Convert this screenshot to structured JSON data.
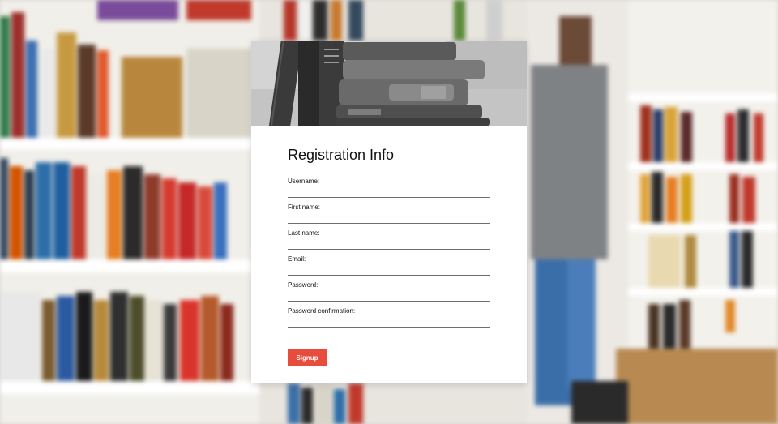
{
  "form": {
    "title": "Registration Info",
    "fields": [
      {
        "label": "Username:",
        "value": "",
        "type": "text"
      },
      {
        "label": "First name:",
        "value": "",
        "type": "text"
      },
      {
        "label": "Last name:",
        "value": "",
        "type": "text"
      },
      {
        "label": "Email:",
        "value": "",
        "type": "email"
      },
      {
        "label": "Password:",
        "value": "",
        "type": "password"
      },
      {
        "label": "Password confirmation:",
        "value": "",
        "type": "password"
      }
    ],
    "submit_label": "Signup"
  },
  "colors": {
    "accent": "#e74c3c",
    "card_background": "#ffffff",
    "input_underline": "#6e6e6e"
  }
}
